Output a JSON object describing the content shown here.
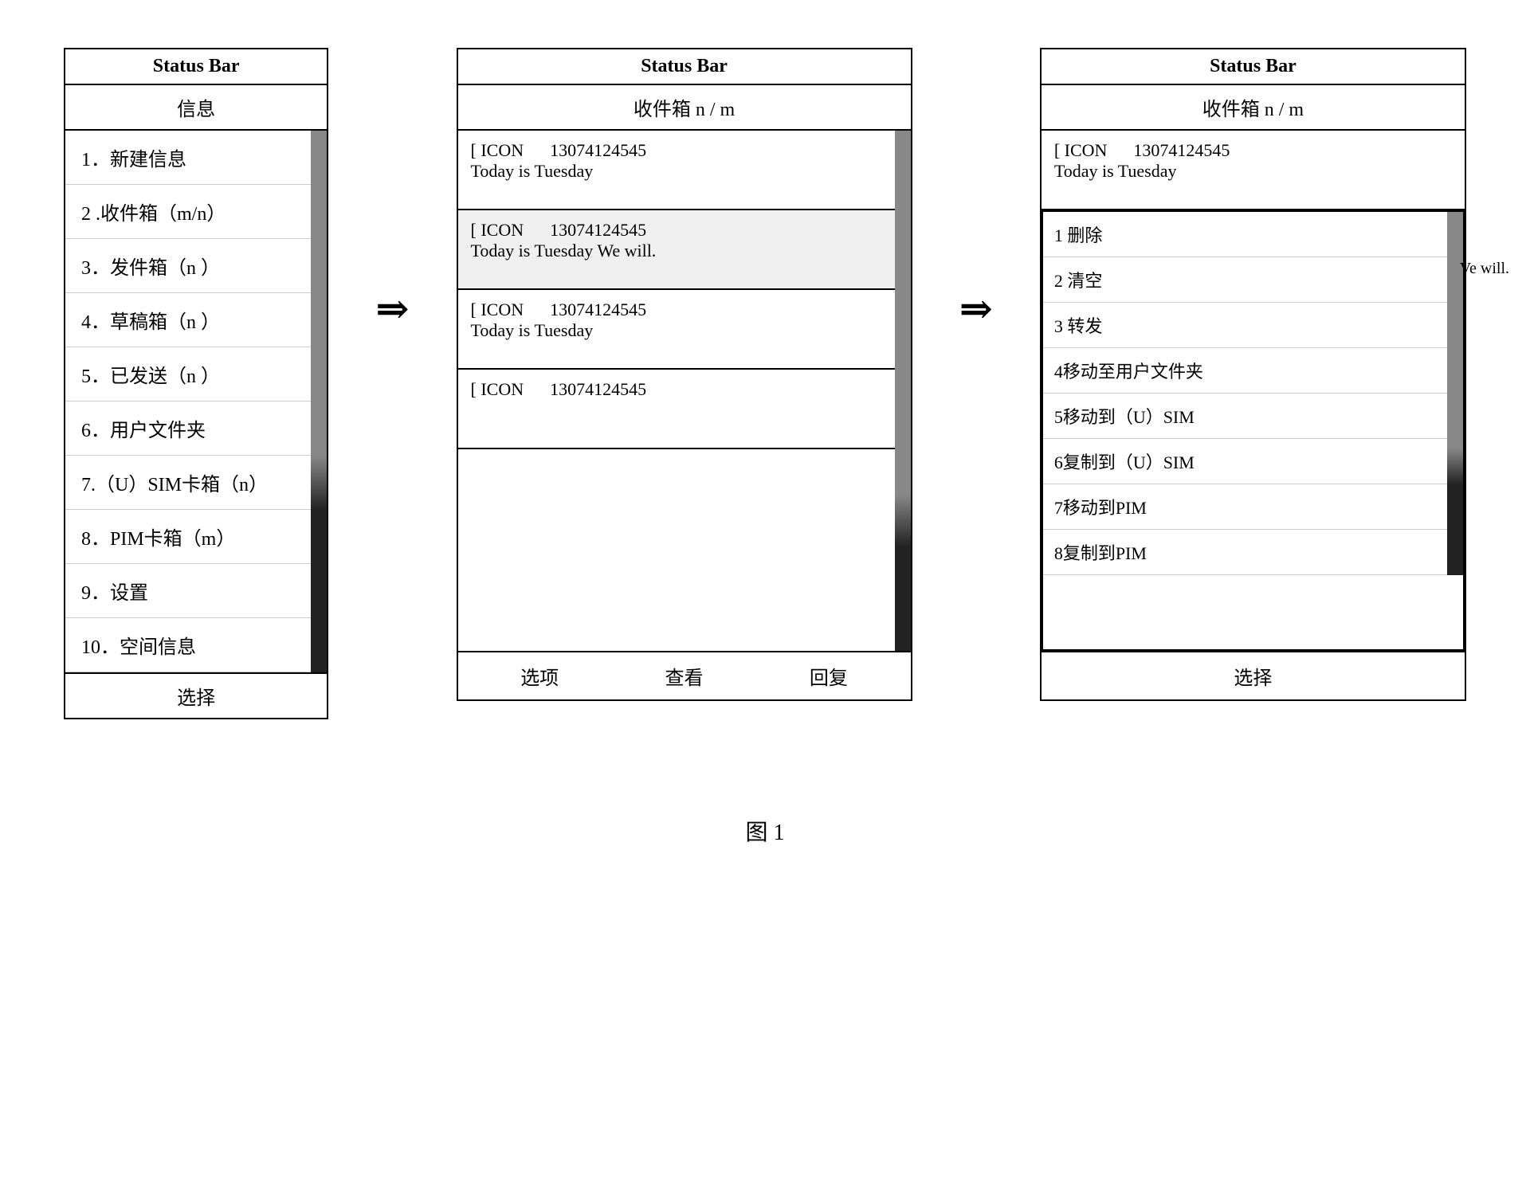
{
  "panel1": {
    "status_bar": "Status Bar",
    "section_title": "信息",
    "menu_items": [
      "1．新建信息",
      "2 .收件箱（m/n）",
      "3．发件箱（n ）",
      "4．草稿箱（n ）",
      "5．已发送（n ）",
      "6．用户文件夹",
      "7.（U）SIM卡箱（n）",
      "8．PIM卡箱（m）",
      "9．设置",
      "10．空间信息"
    ],
    "bottom_bar": "选择"
  },
  "panel2": {
    "status_bar": "Status Bar",
    "inbox_header": "收件箱    n  /  m",
    "messages": [
      {
        "icon": "[ ICON",
        "number": "13074124545",
        "preview": "Today is Tuesday"
      },
      {
        "icon": "[ ICON",
        "number": "13074124545",
        "preview": "Today is Tuesday We will."
      },
      {
        "icon": "[ ICON",
        "number": "13074124545",
        "preview": "Today is Tuesday"
      },
      {
        "icon": "[ ICON",
        "number": "13074124545",
        "preview": ""
      }
    ],
    "bottom_actions": [
      "选项",
      "查看",
      "回复"
    ]
  },
  "panel3": {
    "status_bar": "Status Bar",
    "inbox_header": "收件箱    n  /  m",
    "message_preview": {
      "icon": "[ ICON",
      "number": "13074124545",
      "text": "Today is Tuesday"
    },
    "overflow_text": "Ve will.",
    "context_menu_items": [
      "1  删除",
      "2  清空",
      "3  转发",
      "4移动至用户文件夹",
      "5移动到（U）SIM",
      "6复制到（U）SIM",
      "7移动到PIM",
      "8复制到PIM"
    ],
    "bottom_bar": "选择"
  },
  "arrows": {
    "arrow1": "⇒",
    "arrow2": "⇒"
  },
  "figure_caption": "图 1"
}
